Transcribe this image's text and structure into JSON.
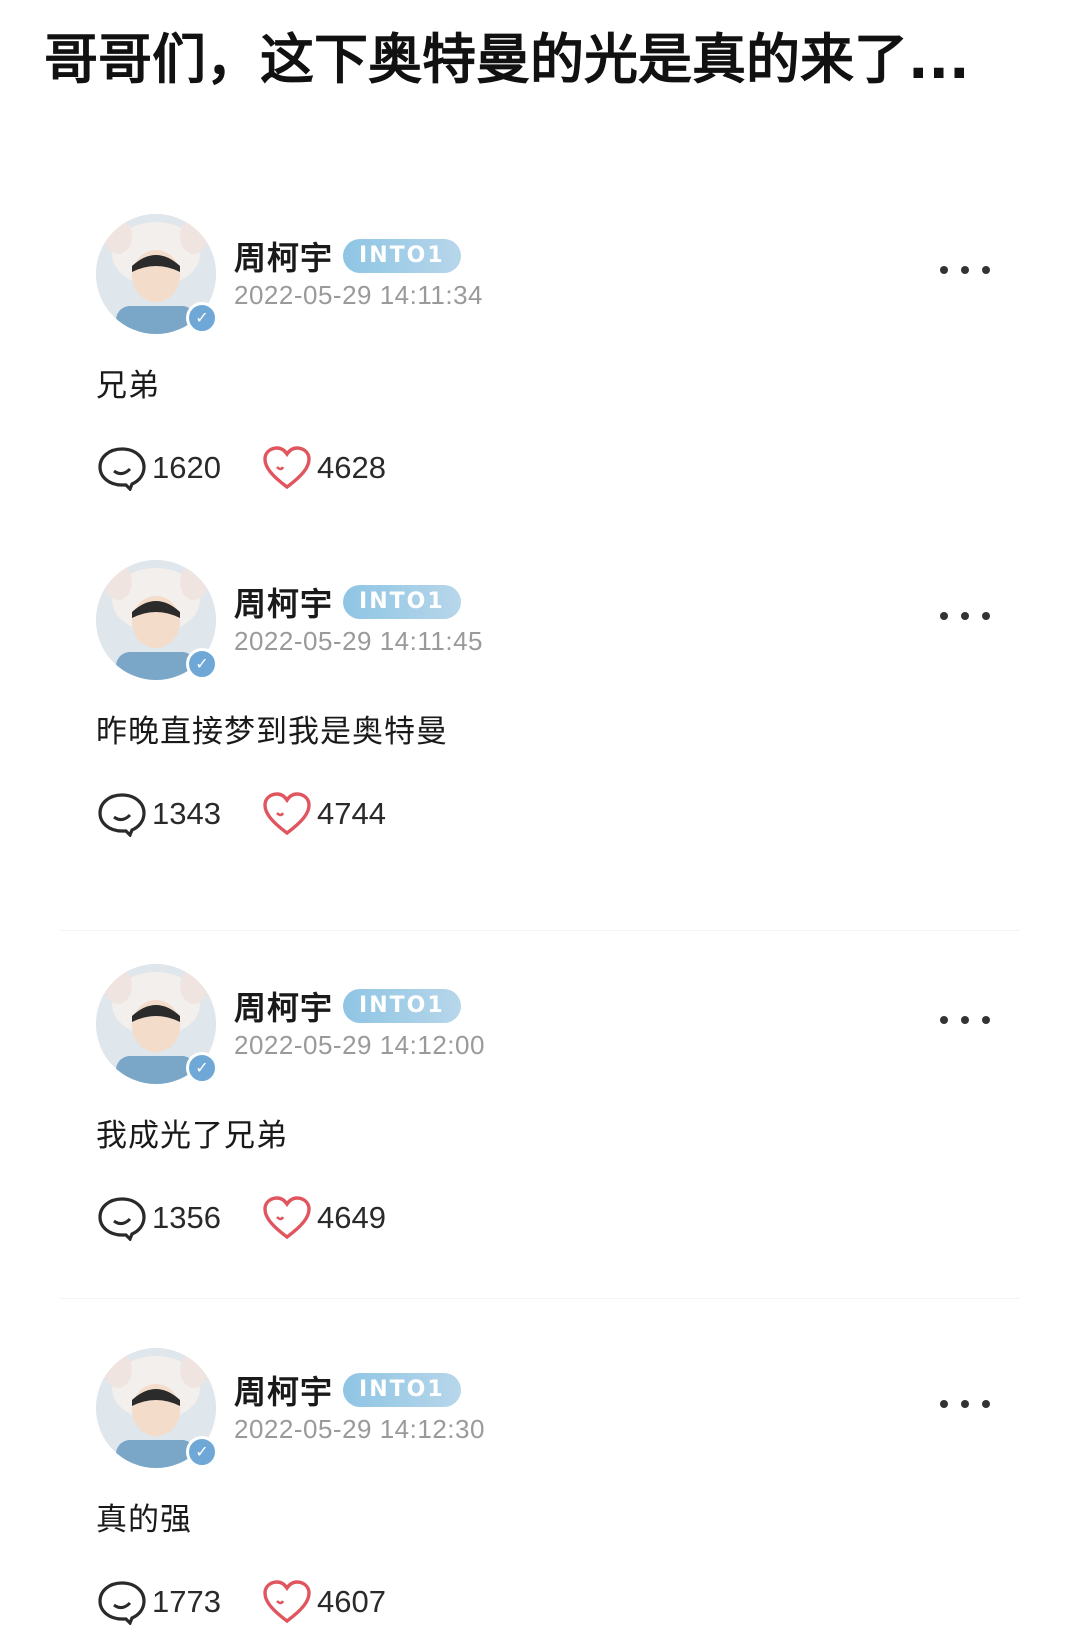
{
  "headline": "哥哥们，这下奥特曼的光是真的来了...",
  "colors": {
    "badge": "#8ec5e4",
    "verified": "#6fa8d6",
    "heart": "#e0555e",
    "timestamp": "#9a9a9a"
  },
  "posts": [
    {
      "username": "周柯宇",
      "badge": "INTO1",
      "verified_icon": "verified-check-icon",
      "timestamp": "2022-05-29 14:11:34",
      "content": "兄弟",
      "comments": "1620",
      "likes": "4628"
    },
    {
      "username": "周柯宇",
      "badge": "INTO1",
      "verified_icon": "verified-check-icon",
      "timestamp": "2022-05-29 14:11:45",
      "content": "昨晚直接梦到我是奥特曼",
      "comments": "1343",
      "likes": "4744"
    },
    {
      "username": "周柯宇",
      "badge": "INTO1",
      "verified_icon": "verified-check-icon",
      "timestamp": "2022-05-29 14:12:00",
      "content": "我成光了兄弟",
      "comments": "1356",
      "likes": "4649"
    },
    {
      "username": "周柯宇",
      "badge": "INTO1",
      "verified_icon": "verified-check-icon",
      "timestamp": "2022-05-29 14:12:30",
      "content": "真的强",
      "comments": "1773",
      "likes": "4607"
    }
  ]
}
